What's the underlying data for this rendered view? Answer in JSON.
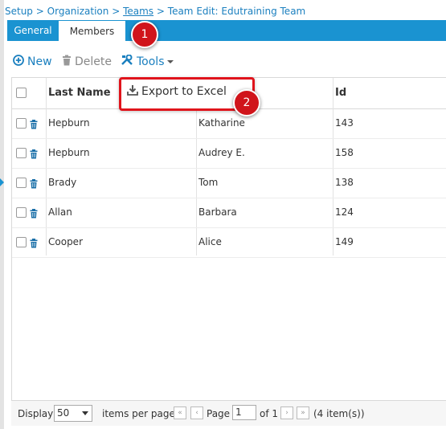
{
  "breadcrumb": {
    "setup": "Setup",
    "sep1": ">",
    "organization": "Organization",
    "sep2": ">",
    "teams": "Teams",
    "sep3": ">",
    "current": "Team Edit: Edutraining Team"
  },
  "tabs": [
    {
      "label": "General",
      "active": false
    },
    {
      "label": "Members",
      "active": true
    }
  ],
  "callouts": {
    "one": "1",
    "two": "2"
  },
  "toolbar": {
    "new_label": "New",
    "delete_label": "Delete",
    "tools_label": "Tools"
  },
  "tools_menu": {
    "export_label": "Export to Excel"
  },
  "grid": {
    "columns": [
      "Last Name",
      "",
      "Id"
    ],
    "rows": [
      {
        "last": "Hepburn",
        "first": "Katharine",
        "id": "143"
      },
      {
        "last": "Hepburn",
        "first": "Audrey E.",
        "id": "158"
      },
      {
        "last": "Brady",
        "first": "Tom",
        "id": "138"
      },
      {
        "last": "Allan",
        "first": "Barbara",
        "id": "124"
      },
      {
        "last": "Cooper",
        "first": "Alice",
        "id": "149"
      }
    ]
  },
  "pager": {
    "display_label": "Display",
    "page_size": "50",
    "items_per_page_label": "items per page",
    "page_label": "Page",
    "page_value": "1",
    "of_label": "of 1",
    "count_label": "(4 item(s))"
  },
  "colors": {
    "accent": "#1a93d1",
    "link": "#1a7fbf",
    "callout": "#d0141b",
    "highlight": "#e0141c"
  },
  "icons": [
    "plus-circle-icon",
    "trash-icon",
    "tools-icon",
    "caret-down-icon",
    "download-icon",
    "first-page-icon",
    "prev-page-icon",
    "next-page-icon",
    "last-page-icon"
  ]
}
